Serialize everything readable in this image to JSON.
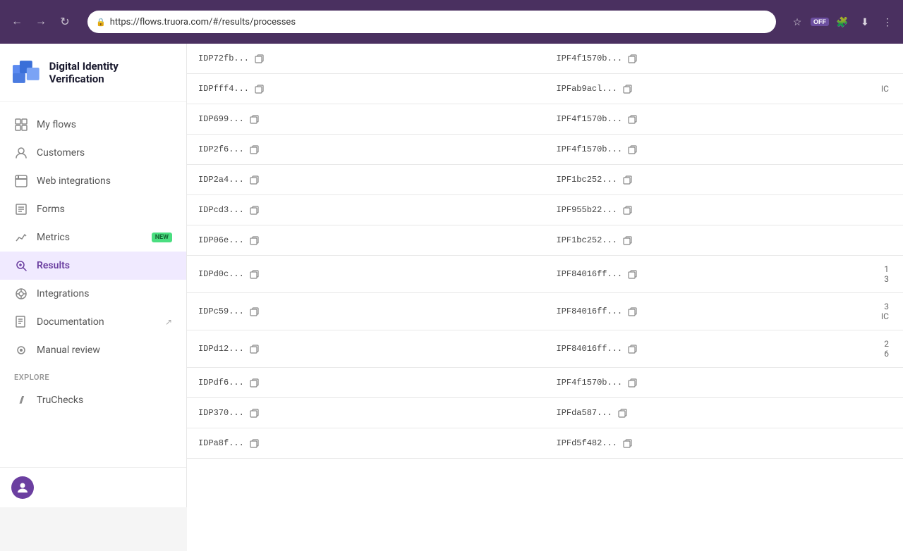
{
  "browser": {
    "url": "https://flows.truora.com/#/results/processes",
    "back_label": "←",
    "forward_label": "→",
    "reload_label": "↻"
  },
  "sidebar": {
    "logo_text": "Digital Identity Verification",
    "nav_items": [
      {
        "id": "my-flows",
        "label": "My flows",
        "icon": "⊞"
      },
      {
        "id": "customers",
        "label": "Customers",
        "icon": "👤"
      },
      {
        "id": "web-integrations",
        "label": "Web integrations",
        "icon": "⊟"
      },
      {
        "id": "forms",
        "label": "Forms",
        "icon": "☰"
      },
      {
        "id": "metrics",
        "label": "Metrics",
        "icon": "📈",
        "badge": "NEW"
      },
      {
        "id": "results",
        "label": "Results",
        "icon": "🔍",
        "active": true
      },
      {
        "id": "integrations",
        "label": "Integrations",
        "icon": "⊛"
      },
      {
        "id": "documentation",
        "label": "Documentation",
        "icon": "📋",
        "external": true
      },
      {
        "id": "manual-review",
        "label": "Manual review",
        "icon": "👁"
      }
    ],
    "explore_label": "Explore",
    "explore_items": [
      {
        "id": "truchecks",
        "label": "TruChecks",
        "icon": "//"
      }
    ]
  },
  "table": {
    "rows": [
      {
        "id1": "IDP72fb...",
        "id2": "IPF4f1570b...",
        "right": ""
      },
      {
        "id1": "IDPfff4...",
        "id2": "IPFab9acl...",
        "right": "IC"
      },
      {
        "id1": "IDP699...",
        "id2": "IPF4f1570b...",
        "right": ""
      },
      {
        "id1": "IDP2f6...",
        "id2": "IPF4f1570b...",
        "right": ""
      },
      {
        "id1": "IDP2a4...",
        "id2": "IPF1bc252...",
        "right": ""
      },
      {
        "id1": "IDPcd3...",
        "id2": "IPF955b22...",
        "right": ""
      },
      {
        "id1": "IDP06e...",
        "id2": "IPF1bc252...",
        "right": ""
      },
      {
        "id1": "IDPd0c...",
        "id2": "IPF84016ff...",
        "right": "1\n3"
      },
      {
        "id1": "IDPc59...",
        "id2": "IPF84016ff...",
        "right": "3\nIC"
      },
      {
        "id1": "IDPd12...",
        "id2": "IPF84016ff...",
        "right": "2\n6"
      },
      {
        "id1": "IDPdf6...",
        "id2": "IPF4f1570b...",
        "right": ""
      },
      {
        "id1": "IDP370...",
        "id2": "IPFda587...",
        "right": ""
      },
      {
        "id1": "IDPa8f...",
        "id2": "IPFd5f482...",
        "right": ""
      }
    ]
  }
}
